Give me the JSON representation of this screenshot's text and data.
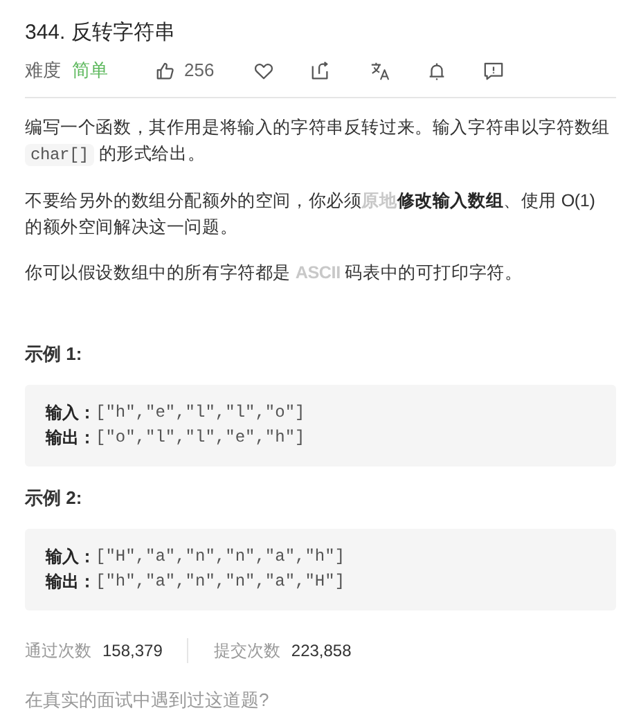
{
  "title": "344. 反转字符串",
  "meta": {
    "difficulty_label": "难度",
    "difficulty": "简单",
    "likes": "256",
    "actions": [
      {
        "kind": "like"
      },
      {
        "kind": "favorite"
      },
      {
        "kind": "share"
      },
      {
        "kind": "translate"
      },
      {
        "kind": "notify"
      },
      {
        "kind": "feedback"
      }
    ]
  },
  "description": [
    [
      {
        "kind": "text",
        "text": "编写一个函数，其作用是将输入的字符串反转过来。输入字符串以字符数组 "
      },
      {
        "kind": "code",
        "text": "char[]"
      },
      {
        "kind": "text",
        "text": " 的形式给出。"
      }
    ],
    [
      {
        "kind": "text",
        "text": "不要给另外的数组分配额外的空间，你必须"
      },
      {
        "kind": "faint",
        "text": "原地"
      },
      {
        "kind": "bold",
        "text": "修改输入数组"
      },
      {
        "kind": "text",
        "text": "、使用 O(1) 的额外空间解决这一问题。"
      }
    ],
    [
      {
        "kind": "text",
        "text": "你可以假设数组中的所有字符都是 "
      },
      {
        "kind": "faint",
        "text": "ASCII"
      },
      {
        "kind": "text",
        "text": " 码表中的可打印字符。"
      }
    ]
  ],
  "examples": [
    {
      "heading": "示例 1:",
      "lines": [
        {
          "label": "输入：",
          "value": "[\"h\",\"e\",\"l\",\"l\",\"o\"]"
        },
        {
          "label": "输出：",
          "value": "[\"o\",\"l\",\"l\",\"e\",\"h\"]"
        }
      ]
    },
    {
      "heading": "示例 2:",
      "lines": [
        {
          "label": "输入：",
          "value": "[\"H\",\"a\",\"n\",\"n\",\"a\",\"h\"]"
        },
        {
          "label": "输出：",
          "value": "[\"h\",\"a\",\"n\",\"n\",\"a\",\"H\"]"
        }
      ]
    }
  ],
  "stats": [
    {
      "label": "通过次数",
      "value": "158,379"
    },
    {
      "label": "提交次数",
      "value": "223,858"
    }
  ],
  "footer": "在真实的面试中遇到过这道题?"
}
